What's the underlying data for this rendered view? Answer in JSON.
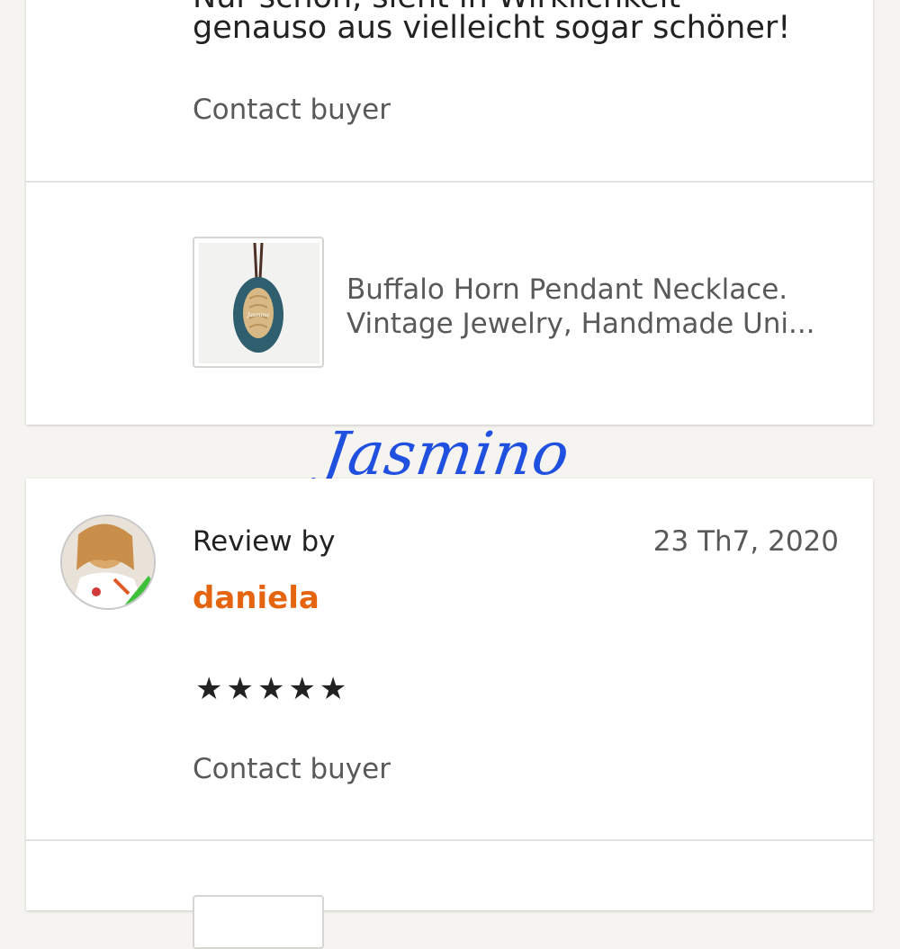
{
  "review1": {
    "text_line1": "Nur schön, sieht in Wirklichkeit",
    "text_line2": "genauso aus vielleicht sogar schöner!",
    "contact_label": "Contact buyer",
    "product": {
      "title_line1": "Buffalo Horn Pendant Necklace.",
      "title_line2": "Vintage Jewelry, Handmade Uni..."
    }
  },
  "watermark": "Jasmino",
  "review2": {
    "review_by_label": "Review by",
    "reviewer": "daniela",
    "date": "23 Th7, 2020",
    "rating": 5,
    "stars": "★★★★★",
    "contact_label": "Contact buyer"
  },
  "colors": {
    "reviewer_name": "#e5640f",
    "watermark": "#2050e0",
    "pendant": "#2f5f6e"
  }
}
